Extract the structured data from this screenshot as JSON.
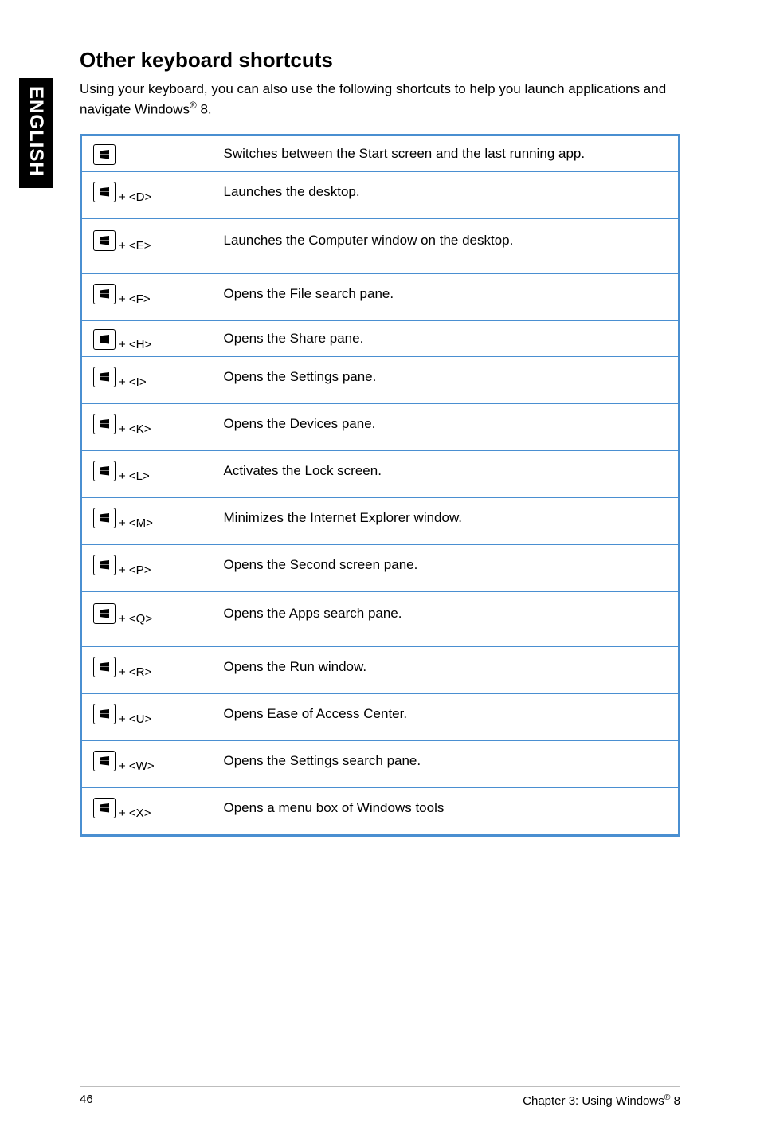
{
  "sidebar_label": "ENGLISH",
  "heading": "Other keyboard shortcuts",
  "intro_pre": "Using your keyboard, you can also use the following shortcuts to help you launch applications and navigate Windows",
  "intro_reg": "®",
  "intro_post": " 8.",
  "shortcuts": [
    {
      "key": null,
      "desc": "Switches between the Start screen and the last running app.",
      "size": "norm"
    },
    {
      "key": "+ <D>",
      "desc": "Launches the desktop.",
      "size": "med"
    },
    {
      "key": "+ <E>",
      "desc": "Launches the Computer window on the desktop.",
      "size": "tall"
    },
    {
      "key": "+ <F>",
      "desc": "Opens the File search pane.",
      "size": "med"
    },
    {
      "key": "+ <H>",
      "desc": "Opens the Share pane.",
      "size": "norm"
    },
    {
      "key": "+ <I>",
      "desc": "Opens the Settings pane.",
      "size": "med"
    },
    {
      "key": "+ <K>",
      "desc": "Opens the Devices pane.",
      "size": "med"
    },
    {
      "key": "+ <L>",
      "desc": "Activates the Lock screen.",
      "size": "med"
    },
    {
      "key": "+ <M>",
      "desc": "Minimizes the Internet Explorer window.",
      "size": "med"
    },
    {
      "key": "+ <P>",
      "desc": "Opens the Second screen pane.",
      "size": "med"
    },
    {
      "key": "+ <Q>",
      "desc": "Opens the Apps search pane.",
      "size": "tall"
    },
    {
      "key": "+ <R>",
      "desc": "Opens the Run window.",
      "size": "med"
    },
    {
      "key": "+ <U>",
      "desc": "Opens Ease of Access Center.",
      "size": "med"
    },
    {
      "key": "+ <W>",
      "desc": "Opens the Settings search pane.",
      "size": "med"
    },
    {
      "key": "+ <X>",
      "desc": "Opens a menu box of Windows tools",
      "size": "med"
    }
  ],
  "footer": {
    "page": "46",
    "chapter_pre": "Chapter 3: Using Windows",
    "chapter_reg": "®",
    "chapter_post": " 8"
  }
}
